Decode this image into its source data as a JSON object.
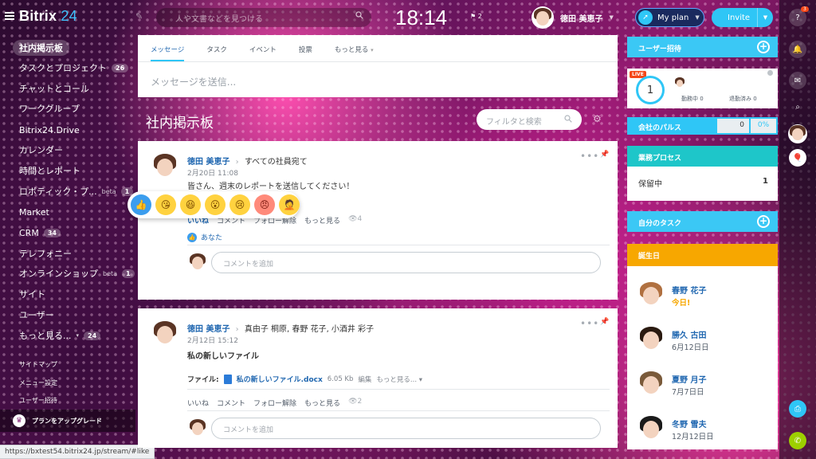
{
  "app": {
    "logo_main": "Bitrix",
    "logo_num": "24"
  },
  "topbar": {
    "search_placeholder": "人や文書などを見つける",
    "clock": "18:14",
    "flag_count": "2",
    "user_name": "徳田 美恵子",
    "myplan_label": "My plan",
    "invite_label": "Invite"
  },
  "sidebar": {
    "items": [
      {
        "label": "社内掲示板",
        "badge": ""
      },
      {
        "label": "タスクとプロジェクト",
        "badge": "26"
      },
      {
        "label": "チャットとコール",
        "badge": ""
      },
      {
        "label": "ワークグループ",
        "badge": ""
      },
      {
        "label": "Bitrix24.Drive",
        "badge": ""
      },
      {
        "label": "カレンダー",
        "badge": ""
      },
      {
        "label": "時間とレポート",
        "badge": ""
      },
      {
        "label": "ロボティック・プ...",
        "badge": "1",
        "beta": "beta"
      },
      {
        "label": "Market",
        "badge": ""
      },
      {
        "label": "CRM",
        "badge": "34"
      },
      {
        "label": "テレフォニー",
        "badge": ""
      },
      {
        "label": "オンラインショップ",
        "badge": "1",
        "beta": "beta"
      },
      {
        "label": "サイト",
        "badge": ""
      },
      {
        "label": "ユーザー",
        "badge": ""
      },
      {
        "label": "もっと見る...",
        "badge": "24"
      }
    ],
    "links": [
      "サイトマップ",
      "メニュー設定",
      "ユーザー招待"
    ],
    "upgrade_label": "プランをアップグレード"
  },
  "status_url": "https://bxtest54.bitrix24.jp/stream/#like",
  "composer": {
    "tabs": [
      "メッセージ",
      "タスク",
      "イベント",
      "投票",
      "もっと見る"
    ],
    "placeholder": "メッセージを送信..."
  },
  "feed": {
    "title": "社内掲示板",
    "filter_placeholder": "フィルタと検索"
  },
  "posts": [
    {
      "author": "徳田 美恵子",
      "recipients": "すべての社員宛て",
      "date": "2月20日 11:08",
      "text": "皆さん、週末のレポートを送信してください！",
      "actions": [
        "いいね",
        "コメント",
        "フォロー解除",
        "もっと見る"
      ],
      "views": "4",
      "liked_by": "あなた",
      "comment_placeholder": "コメントを追加"
    },
    {
      "author": "徳田 美恵子",
      "recipients": "真由子 桐原, 春野 花子, 小酒井 彩子",
      "date": "2月12日 15:12",
      "text": "私の新しいファイル",
      "file_label": "ファイル:",
      "file_name": "私の新しいファイル.docx",
      "file_size": "6.05 Kb",
      "file_edit": "編集",
      "file_more": "もっと見る...",
      "actions": [
        "いいね",
        "コメント",
        "フォロー解除",
        "もっと見る"
      ],
      "views": "2",
      "comment_placeholder": "コメントを追加"
    }
  ],
  "reactions": [
    "like-icon",
    "kiss-icon",
    "laugh-icon",
    "wonder-icon",
    "cry-icon",
    "angry-icon",
    "facepalm-icon"
  ],
  "right": {
    "invite_header": "ユーザー招待",
    "live": "LIVE",
    "online_count": "1",
    "working_label": "勤務中",
    "working_count": "0",
    "left_label": "退勤済み",
    "left_count": "0",
    "pulse_header": "会社のパルス",
    "pulse_value": "0",
    "pulse_percent": "0%",
    "process_header": "業務プロセス",
    "pending_label": "保留中",
    "pending_count": "1",
    "tasks_header": "自分のタスク",
    "birthday_header": "誕生日",
    "birthdays": [
      {
        "name": "春野 花子",
        "date": "今日!"
      },
      {
        "name": "勝久 古田",
        "date": "6月12日日"
      },
      {
        "name": "夏野 月子",
        "date": "7月7日日"
      },
      {
        "name": "冬野 雪夫",
        "date": "12月12日日"
      }
    ]
  },
  "rail": {
    "help_badge": "3"
  },
  "colors": {
    "accent": "#2fc6f6",
    "link": "#2067b0",
    "invite_header": "#3bc8f5",
    "pulse_header": "#2fc6f6",
    "process_header": "#1ec6c9",
    "birthday_header": "#f7a700",
    "call": "#9dcf00"
  }
}
